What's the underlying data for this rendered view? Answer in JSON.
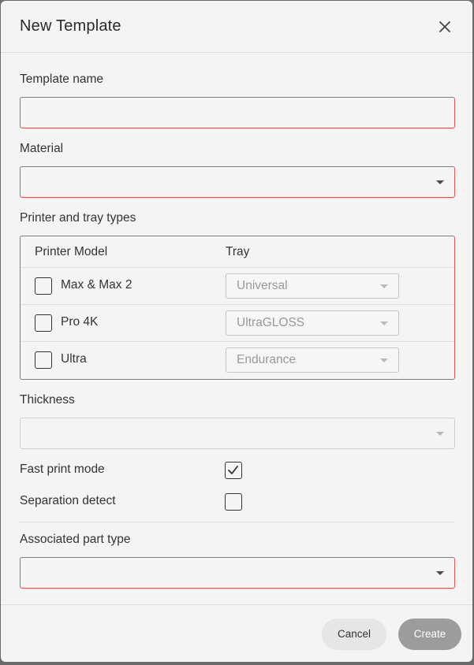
{
  "dialog": {
    "title": "New Template",
    "close_icon": "close-icon"
  },
  "template_name": {
    "label": "Template name",
    "value": ""
  },
  "material": {
    "label": "Material",
    "value": ""
  },
  "printer_tray": {
    "label": "Printer and tray types",
    "columns": [
      "Printer Model",
      "Tray"
    ],
    "rows": [
      {
        "model": "Max & Max 2",
        "tray": "Universal",
        "checked": false
      },
      {
        "model": "Pro 4K",
        "tray": "UltraGLOSS",
        "checked": false
      },
      {
        "model": "Ultra",
        "tray": "Endurance",
        "checked": false
      }
    ]
  },
  "thickness": {
    "label": "Thickness",
    "value": ""
  },
  "fast_print_mode": {
    "label": "Fast print mode",
    "checked": true
  },
  "separation_detect": {
    "label": "Separation detect",
    "checked": false
  },
  "associated_part_type": {
    "label": "Associated part type",
    "value": ""
  },
  "footer": {
    "cancel_label": "Cancel",
    "create_label": "Create"
  },
  "colors": {
    "error_border": "#e0554f",
    "create_button": "#9c9c9c",
    "cancel_button": "#e6e6e6"
  }
}
